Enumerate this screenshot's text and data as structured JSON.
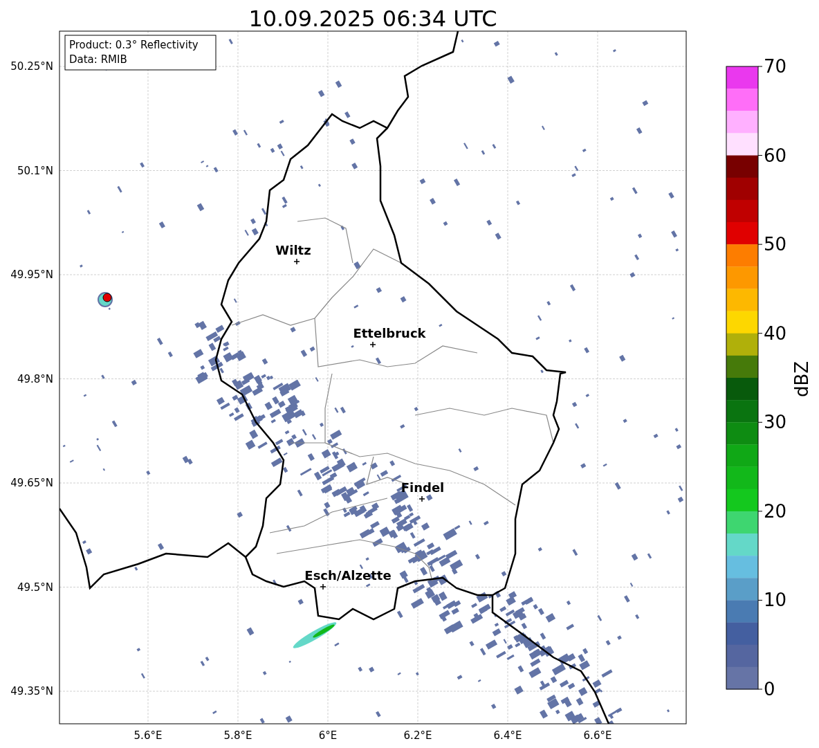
{
  "title": "10.09.2025 06:34 UTC",
  "info_box": [
    "Product: 0.3° Reflectivity",
    "Data: RMIB"
  ],
  "cities": [
    {
      "name": "Wiltz"
    },
    {
      "name": "Ettelbruck"
    },
    {
      "name": "Findel"
    },
    {
      "name": "Esch/Alzette"
    }
  ],
  "lat_ticks": [
    "50.25°N",
    "50.1°N",
    "49.95°N",
    "49.8°N",
    "49.65°N",
    "49.5°N",
    "49.35°N"
  ],
  "lon_ticks": [
    "5.6°E",
    "5.8°E",
    "6°E",
    "6.2°E",
    "6.4°E",
    "6.6°E"
  ],
  "colorbar": {
    "label": "dBZ",
    "ticks": [
      "70",
      "60",
      "50",
      "40",
      "30",
      "20",
      "10",
      "0"
    ],
    "segments": [
      {
        "color": "#ea38ee"
      },
      {
        "color": "#ff6ef8"
      },
      {
        "color": "#ffb0ff"
      },
      {
        "color": "#ffe0ff"
      },
      {
        "color": "#780000"
      },
      {
        "color": "#a00000"
      },
      {
        "color": "#c00000"
      },
      {
        "color": "#e00000"
      },
      {
        "color": "#fd7d00"
      },
      {
        "color": "#fd9800"
      },
      {
        "color": "#fdb800"
      },
      {
        "color": "#fdd700"
      },
      {
        "color": "#b0b00a"
      },
      {
        "color": "#467a0a"
      },
      {
        "color": "#085a0c"
      },
      {
        "color": "#0a7410"
      },
      {
        "color": "#0e8c12"
      },
      {
        "color": "#10a816"
      },
      {
        "color": "#12b81a"
      },
      {
        "color": "#14c81e"
      },
      {
        "color": "#3ed670"
      },
      {
        "color": "#64d8c8"
      },
      {
        "color": "#66bee0"
      },
      {
        "color": "#5a9ec8"
      },
      {
        "color": "#4a7bb2"
      },
      {
        "color": "#445fa0"
      },
      {
        "color": "#5566a0"
      },
      {
        "color": "#6674a6"
      }
    ]
  }
}
